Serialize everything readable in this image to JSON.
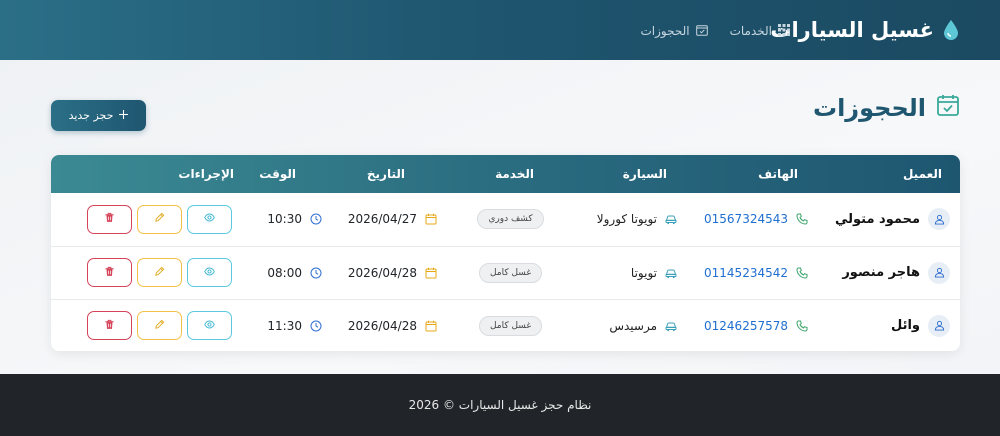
{
  "brand": {
    "title": "غسيل السيارات",
    "icon": "water-drop-icon"
  },
  "nav": [
    {
      "label": "الخدمات",
      "icon": "grid-icon"
    },
    {
      "label": "الحجوزات",
      "icon": "calendar-check-icon"
    }
  ],
  "page": {
    "title": "الحجوزات",
    "new_button": "حجز جديد"
  },
  "table": {
    "headers": {
      "client": "العميل",
      "phone": "الهاتف",
      "car": "السيارة",
      "service": "الخدمة",
      "date": "التاريخ",
      "time": "الوقت",
      "actions": "الإجراءات"
    },
    "rows": [
      {
        "client": "محمود متولي",
        "phone": "01567324543",
        "car": "تويوتا كورولا",
        "service": "كشف دوري",
        "date": "2026/04/27",
        "time": "10:30"
      },
      {
        "client": "هاجر منصور",
        "phone": "01145234542",
        "car": "تويوتا",
        "service": "غسل كامل",
        "date": "2026/04/28",
        "time": "08:00"
      },
      {
        "client": "وائل",
        "phone": "01246257578",
        "car": "مرسيدس",
        "service": "غسل كامل",
        "date": "2026/04/28",
        "time": "11:30"
      }
    ]
  },
  "footer": {
    "text": "نظام حجز غسيل السيارات © 2026"
  },
  "colors": {
    "primary": "#1f5670",
    "accent_teal": "#3b8a93",
    "phone_blue": "#1f6fd0",
    "view": "#5cc9e0",
    "edit": "#f5c04a",
    "delete": "#d6445a",
    "footer_bg": "#212529"
  }
}
